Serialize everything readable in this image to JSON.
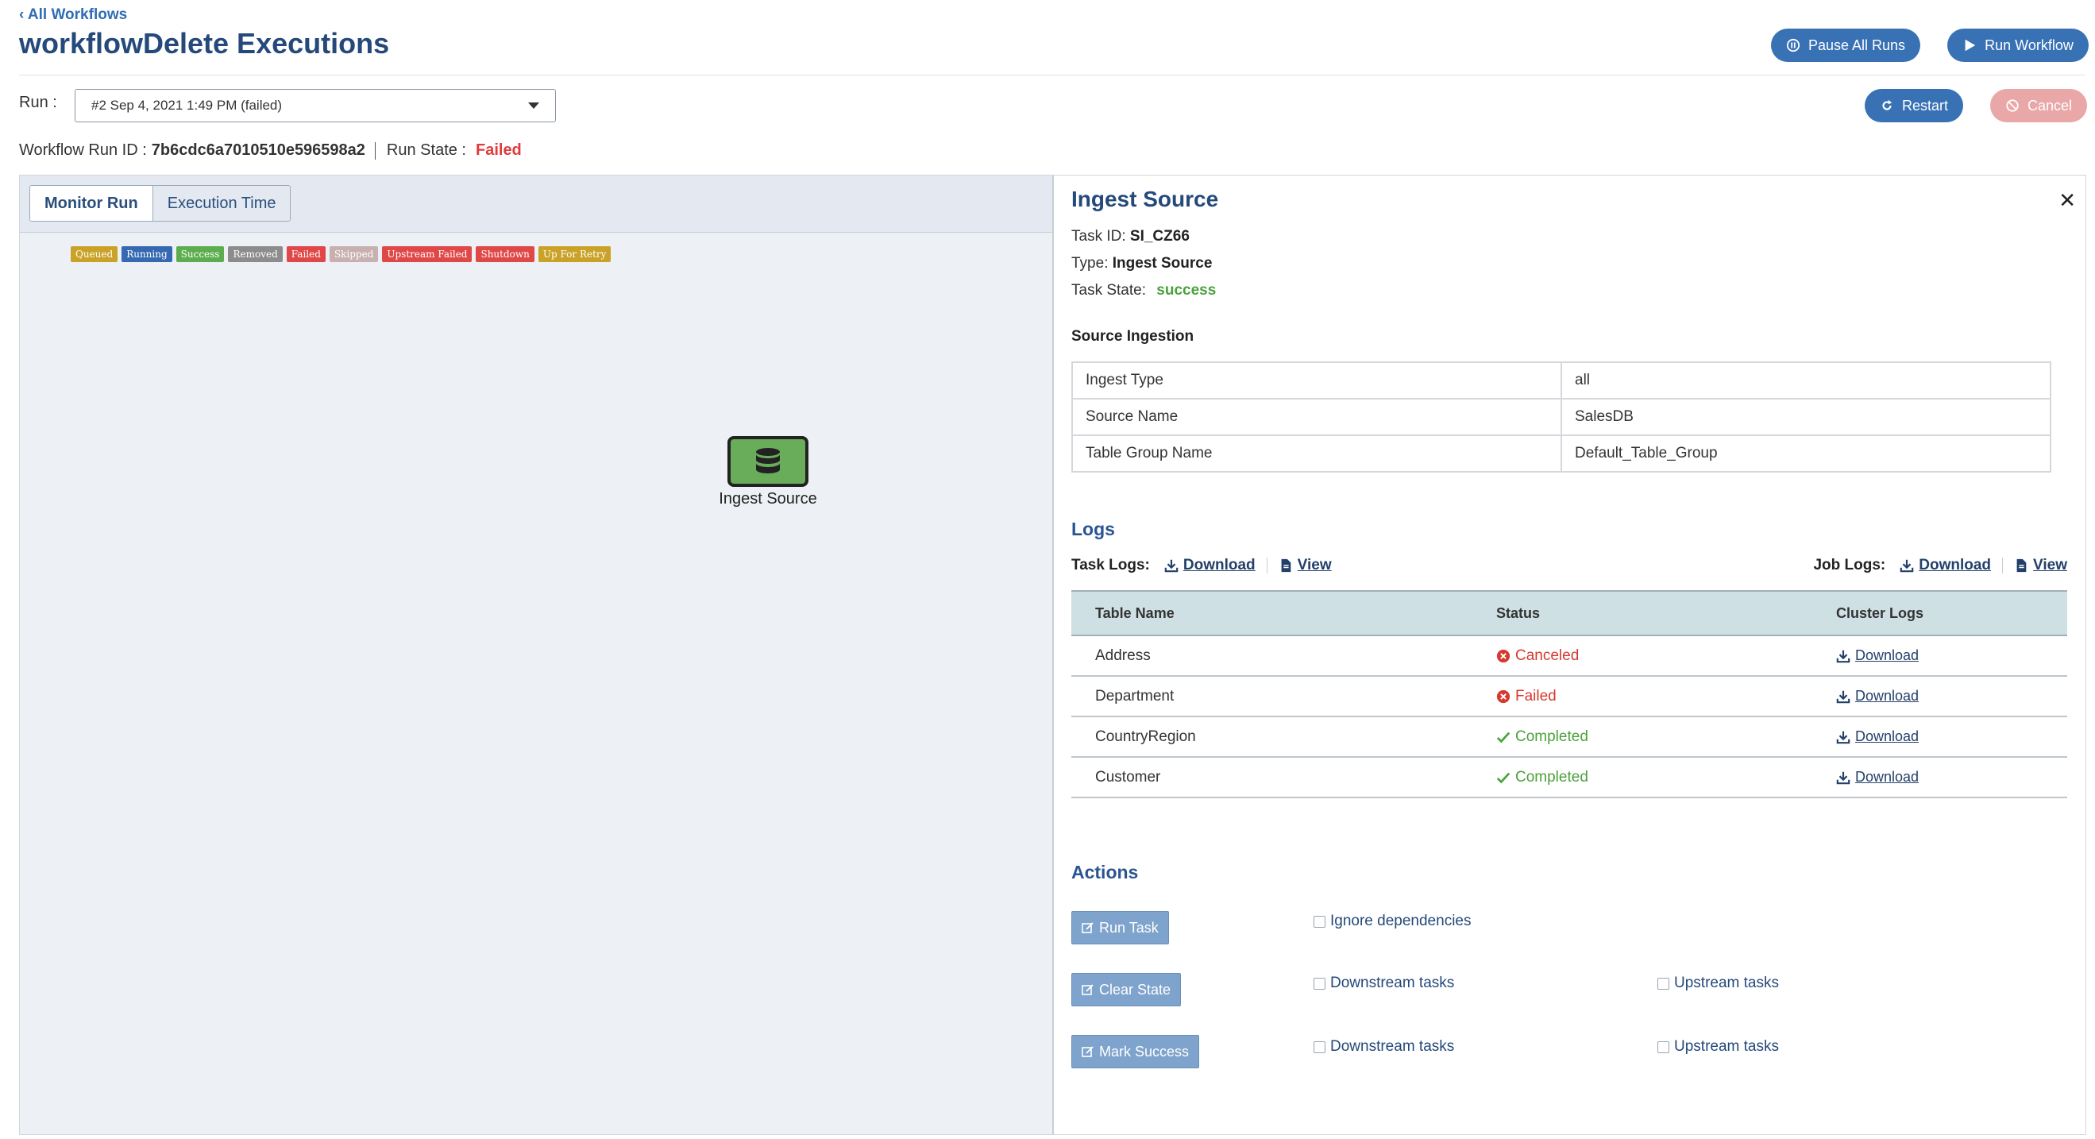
{
  "header": {
    "back_link": "All Workflows",
    "title": "workflowDelete Executions",
    "pause_all_label": "Pause All Runs",
    "run_workflow_label": "Run Workflow",
    "restart_label": "Restart",
    "cancel_label": "Cancel"
  },
  "run": {
    "label": "Run :",
    "selected": "#2 Sep 4, 2021 1:49 PM (failed)",
    "id_label": "Workflow Run ID :",
    "id_value": "7b6cdc6a7010510e596598a2",
    "state_label": "Run State :",
    "state_value": "Failed"
  },
  "tabs": [
    {
      "label": "Monitor Run",
      "active": true
    },
    {
      "label": "Execution Time",
      "active": false
    }
  ],
  "legend": [
    {
      "label": "Queued",
      "color": "#c9a227"
    },
    {
      "label": "Running",
      "color": "#3569b2"
    },
    {
      "label": "Success",
      "color": "#5cad4e"
    },
    {
      "label": "Removed",
      "color": "#8c8c8c"
    },
    {
      "label": "Failed",
      "color": "#e04848"
    },
    {
      "label": "Skipped",
      "color": "#c9b0b0"
    },
    {
      "label": "Upstream Failed",
      "color": "#e04848"
    },
    {
      "label": "Shutdown",
      "color": "#e04848"
    },
    {
      "label": "Up For Retry",
      "color": "#c9a227"
    }
  ],
  "node": {
    "label": "Ingest Source",
    "icon": "database-icon",
    "color": "#69ad5a"
  },
  "panel": {
    "title": "Ingest Source",
    "task_id_label": "Task ID:",
    "task_id_value": "SI_CZ66",
    "type_label": "Type:",
    "type_value": "Ingest Source",
    "state_label": "Task State:",
    "state_value": "success",
    "source_section": "Source Ingestion",
    "params": [
      {
        "key": "Ingest Type",
        "value": "all"
      },
      {
        "key": "Source Name",
        "value": "SalesDB"
      },
      {
        "key": "Table Group Name",
        "value": "Default_Table_Group"
      }
    ],
    "logs_section": "Logs",
    "task_logs_label": "Task Logs:",
    "job_logs_label": "Job Logs:",
    "download_label": "Download",
    "view_label": "View",
    "log_table": {
      "headers": [
        "Table Name",
        "Status",
        "Cluster Logs"
      ],
      "rows": [
        {
          "table": "Address",
          "status": "Canceled",
          "ok": false,
          "link": "Download"
        },
        {
          "table": "Department",
          "status": "Failed",
          "ok": false,
          "link": "Download"
        },
        {
          "table": "CountryRegion",
          "status": "Completed",
          "ok": true,
          "link": "Download"
        },
        {
          "table": "Customer",
          "status": "Completed",
          "ok": true,
          "link": "Download"
        }
      ]
    },
    "actions_section": "Actions",
    "actions": {
      "run_task": "Run Task",
      "clear_state": "Clear State",
      "mark_success": "Mark Success",
      "ignore_deps": "Ignore dependencies",
      "downstream": "Downstream tasks",
      "upstream": "Upstream tasks"
    }
  }
}
